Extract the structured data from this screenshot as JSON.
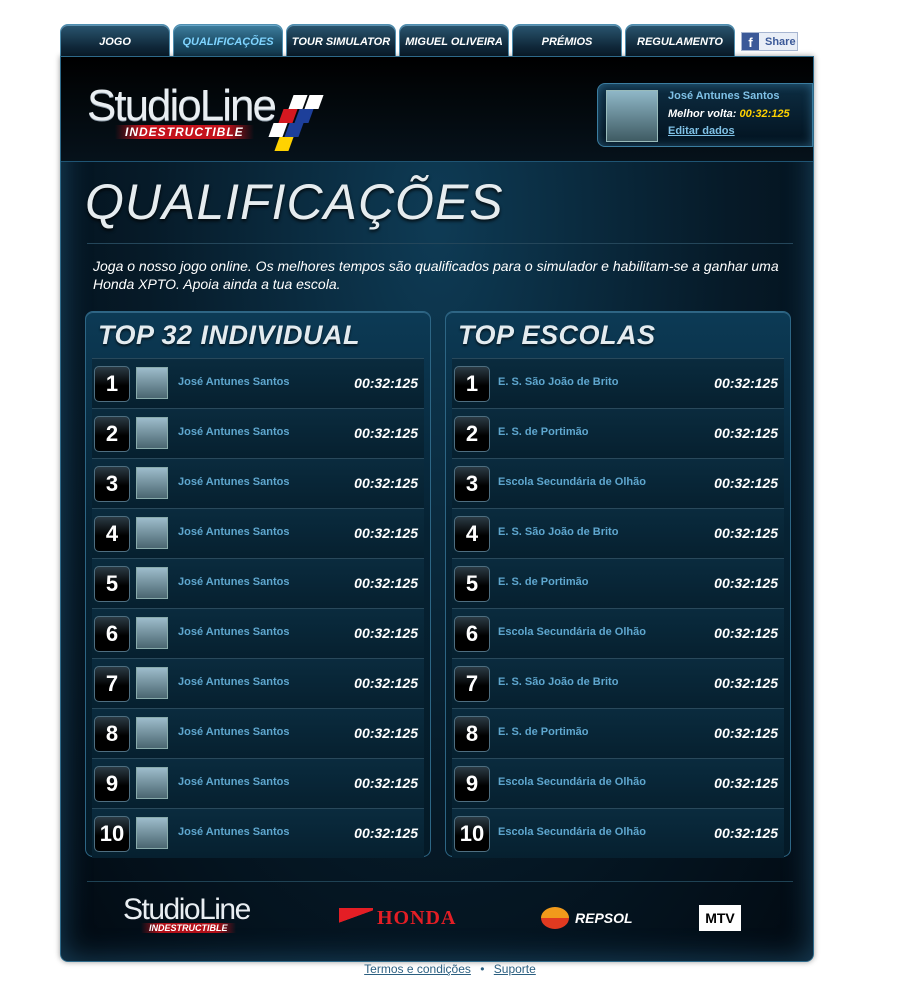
{
  "tabs": [
    {
      "label": "JOGO",
      "active": false
    },
    {
      "label": "QUALIFICAÇÕES",
      "active": true
    },
    {
      "label": "TOUR SIMULATOR",
      "active": false
    },
    {
      "label": "MIGUEL OLIVEIRA",
      "active": false
    },
    {
      "label": "PRÉMIOS",
      "active": false
    },
    {
      "label": "REGULAMENTO",
      "active": false
    }
  ],
  "share": {
    "icon": "facebook-icon",
    "label": "Share"
  },
  "logo": {
    "main": "StudioLine",
    "sub": "INDESTRUCTIBLE"
  },
  "user": {
    "name": "José Antunes Santos",
    "lap_label": "Melhor volta:",
    "lap_time": "00:32:125",
    "edit_label": "Editar dados"
  },
  "page": {
    "title": "QUALIFICAÇÕES",
    "intro": "Joga o nosso jogo online. Os melhores tempos são qualificados para o simulador e habilitam-se a ganhar uma Honda XPTO. Apoia ainda a tua escola."
  },
  "top_individual": {
    "title": "TOP 32 INDIVIDUAL",
    "rows": [
      {
        "pos": "1",
        "name": "José Antunes Santos",
        "time": "00:32:125"
      },
      {
        "pos": "2",
        "name": "José Antunes Santos",
        "time": "00:32:125"
      },
      {
        "pos": "3",
        "name": "José Antunes Santos",
        "time": "00:32:125"
      },
      {
        "pos": "4",
        "name": "José Antunes Santos",
        "time": "00:32:125"
      },
      {
        "pos": "5",
        "name": "José Antunes Santos",
        "time": "00:32:125"
      },
      {
        "pos": "6",
        "name": "José Antunes Santos",
        "time": "00:32:125"
      },
      {
        "pos": "7",
        "name": "José Antunes Santos",
        "time": "00:32:125"
      },
      {
        "pos": "8",
        "name": "José Antunes Santos",
        "time": "00:32:125"
      },
      {
        "pos": "9",
        "name": "José Antunes Santos",
        "time": "00:32:125"
      },
      {
        "pos": "10",
        "name": "José Antunes Santos",
        "time": "00:32:125"
      }
    ]
  },
  "top_escolas": {
    "title": "TOP ESCOLAS",
    "rows": [
      {
        "pos": "1",
        "name": "E. S. São João de Brito",
        "time": "00:32:125"
      },
      {
        "pos": "2",
        "name": "E. S. de Portimão",
        "time": "00:32:125"
      },
      {
        "pos": "3",
        "name": "Escola Secundária de Olhão",
        "time": "00:32:125"
      },
      {
        "pos": "4",
        "name": "E. S. São João de Brito",
        "time": "00:32:125"
      },
      {
        "pos": "5",
        "name": "E. S. de Portimão",
        "time": "00:32:125"
      },
      {
        "pos": "6",
        "name": "Escola Secundária de Olhão",
        "time": "00:32:125"
      },
      {
        "pos": "7",
        "name": "E. S. São João de Brito",
        "time": "00:32:125"
      },
      {
        "pos": "8",
        "name": "E. S. de Portimão",
        "time": "00:32:125"
      },
      {
        "pos": "9",
        "name": "Escola Secundária de Olhão",
        "time": "00:32:125"
      },
      {
        "pos": "10",
        "name": "Escola Secundária de Olhão",
        "time": "00:32:125"
      }
    ]
  },
  "sponsors": {
    "studioline_main": "StudioLine",
    "studioline_sub": "INDESTRUCTIBLE",
    "honda": "HONDA",
    "repsol": "REPSOL",
    "mtv": "MTV"
  },
  "footer": {
    "terms": "Termos e condições",
    "separator": "•",
    "support": "Suporte"
  },
  "colors": {
    "accent_blue": "#5fa7cf",
    "time_yellow": "#ffd200",
    "panel_dark": "#061a28"
  }
}
